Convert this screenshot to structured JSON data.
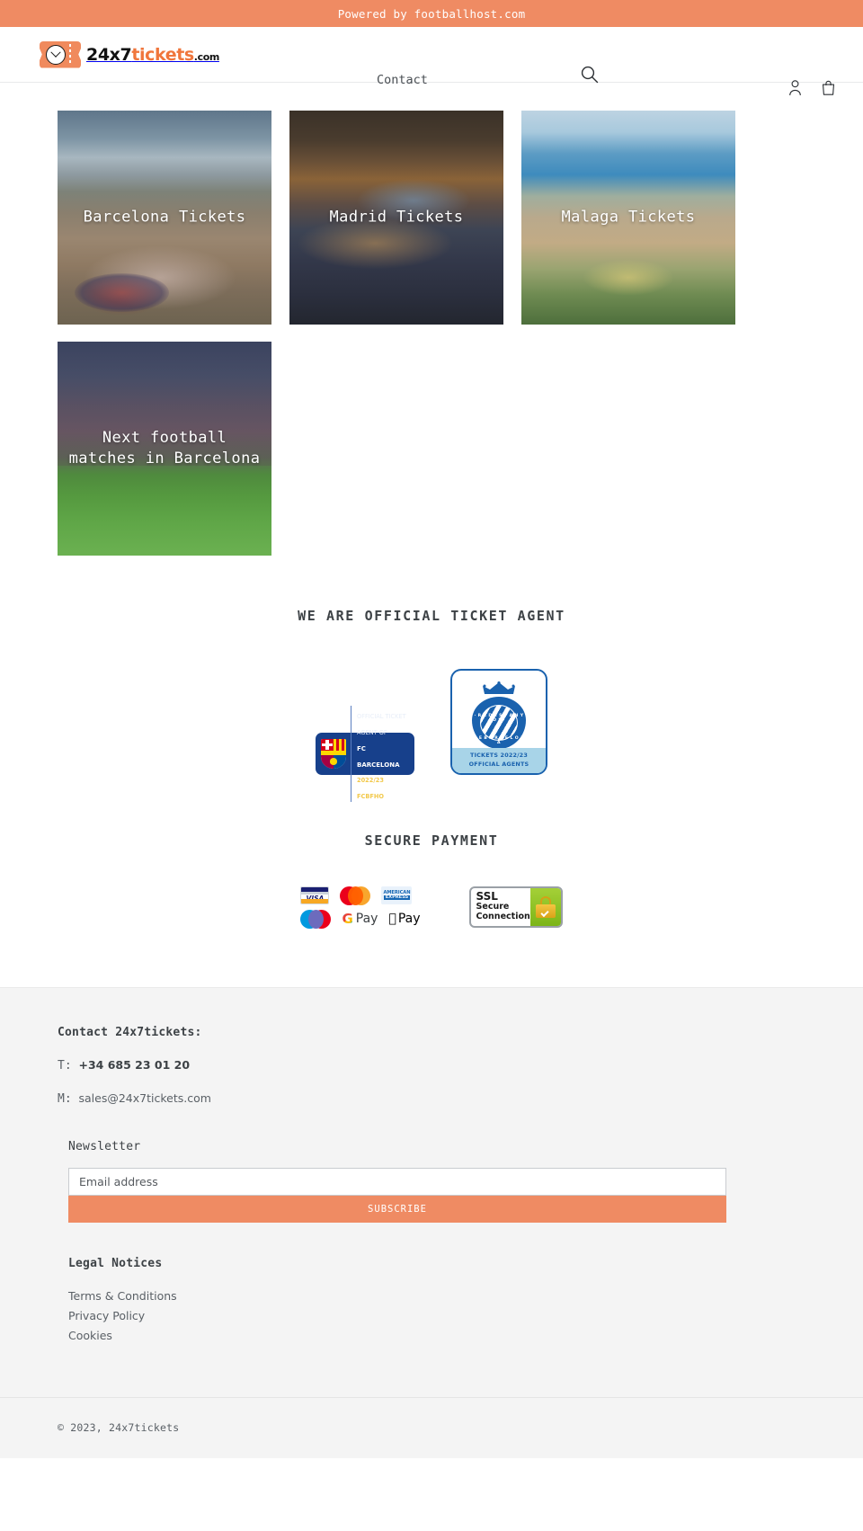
{
  "announcement": {
    "text": "Powered by footballhost.com",
    "bg": "#ef8b63"
  },
  "header": {
    "logo": {
      "part_black": "24x7",
      "part_orange": "tickets",
      "part_suffix": ".com",
      "icon": "ticket-clock-icon"
    },
    "nav": [
      {
        "label": "Contact"
      }
    ],
    "search_icon": "search-icon",
    "account_icon": "account-icon",
    "cart_icon": "shopping-bag-icon"
  },
  "cards": [
    {
      "title": "Barcelona Tickets"
    },
    {
      "title": "Madrid Tickets"
    },
    {
      "title": "Malaga Tickets"
    },
    {
      "title": "Next football matches in Barcelona"
    }
  ],
  "agent_section": {
    "title": "WE ARE OFFICIAL TICKET AGENT",
    "badges": {
      "fcb": {
        "line1": "OFFICIAL TICKET",
        "line2": "AGENT OF",
        "line3": "FC BARCELONA",
        "line4": "2022/23 FCBFHO"
      },
      "espanyol": {
        "crest_top": "· R C D  E S P A N Y O L ·",
        "crest_bottom": "D E  B A R C E L O N A",
        "banner_line1": "TICKETS 2022/23",
        "banner_line2": "OFFICIAL AGENTS"
      }
    }
  },
  "payment_section": {
    "title": "SECURE PAYMENT",
    "methods": [
      "VISA",
      "Mastercard",
      "American Express",
      "Maestro",
      "Google Pay",
      "Apple Pay"
    ],
    "visa_label": "VISA",
    "amex_line1": "AMERICAN",
    "amex_line2": "EXPRESS",
    "gpay_g": "G",
    "gpay_label": "Pay",
    "apay_label": "Pay",
    "ssl": {
      "line1": "SSL",
      "line2": "Secure",
      "line3": "Connection"
    }
  },
  "footer": {
    "contact_title": "Contact 24x7tickets:",
    "phone_prefix": "T: ",
    "phone": "+34 685 23 01 20",
    "email_prefix": "M: ",
    "email": "sales@24x7tickets.com",
    "newsletter": {
      "title": "Newsletter",
      "placeholder": "Email address",
      "value": "",
      "submit_label": "SUBSCRIBE",
      "submit_color": "#ef8b63"
    },
    "legal": {
      "title": "Legal Notices",
      "links": [
        "Terms & Conditions",
        "Privacy Policy",
        "Cookies"
      ]
    },
    "copyright": "© 2023, 24x7tickets"
  }
}
